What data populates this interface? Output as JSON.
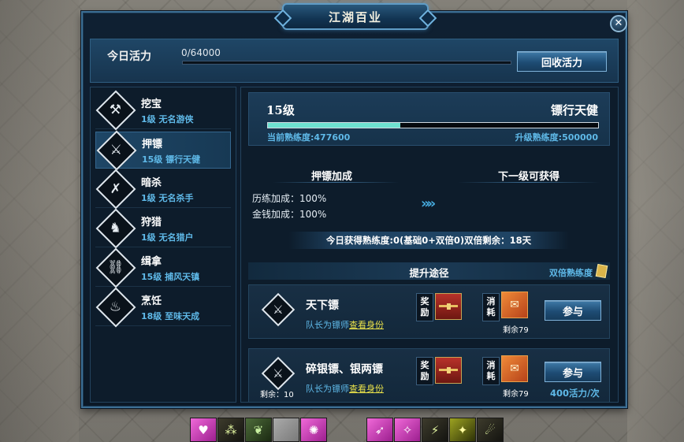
{
  "window": {
    "title": "江湖百业",
    "close_icon": "✕"
  },
  "vitality": {
    "label": "今日活力",
    "value": "0/64000",
    "progress_fraction": 0.0,
    "recycle_button": "回收活力"
  },
  "sidebar": {
    "items": [
      {
        "name": "挖宝",
        "sub": "1级 无名游侠",
        "icon": "shovel-icon",
        "glyph": "⚒"
      },
      {
        "name": "押镖",
        "sub": "15级 镖行天健",
        "icon": "escort-icon",
        "glyph": "⚔"
      },
      {
        "name": "暗杀",
        "sub": "1级 无名杀手",
        "icon": "daggers-icon",
        "glyph": "✗"
      },
      {
        "name": "狩猎",
        "sub": "1级 无名猎户",
        "icon": "deer-icon",
        "glyph": "♞"
      },
      {
        "name": "缉拿",
        "sub": "15级 捕风天镇",
        "icon": "handcuff-icon",
        "glyph": "⛓"
      },
      {
        "name": "烹饪",
        "sub": "18级 至味天成",
        "icon": "cooking-icon",
        "glyph": "♨"
      }
    ],
    "selected_index": 1
  },
  "profession": {
    "level": "15级",
    "rank": "镖行天健",
    "current_label": "当前熟练度:477600",
    "next_label": "升级熟练度:500000",
    "progress_fraction": 0.4
  },
  "bonus": {
    "heading": "押镖加成",
    "next_heading": "下一级可获得",
    "lines": [
      "历练加成：100%",
      "金钱加成：100%"
    ],
    "arrow": "»»"
  },
  "today_line": "今日获得熟练度:0(基础0+双倍0)双倍剩余：18天",
  "routes": {
    "heading": "提升途径",
    "double_label": "双倍熟练度",
    "reward_tag": [
      "奖",
      "励"
    ],
    "cost_tag": [
      "消",
      "耗"
    ],
    "items": [
      {
        "name": "天下镖",
        "leader": "队长为镖师",
        "link": "查看身份",
        "token_remain": "剩余79",
        "join": "参与",
        "remain": "",
        "cost": ""
      },
      {
        "name": "碎银镖、银两镖",
        "leader": "队长为镖师",
        "link": "查看身份",
        "token_remain": "剩余79",
        "join": "参与",
        "remain": "剩余：10",
        "cost": "400活力/次"
      }
    ]
  },
  "hotbar": {
    "left": [
      {
        "icon": "couple-skill-icon",
        "glyph": "♥",
        "style": "pink"
      },
      {
        "icon": "claw-skill-icon",
        "glyph": "⁂",
        "style": "dark"
      },
      {
        "icon": "leaf-skill-icon",
        "glyph": "❦",
        "style": "green"
      },
      {
        "icon": "empty-slot-icon",
        "glyph": "",
        "style": "grey"
      },
      {
        "icon": "burst-skill-icon",
        "glyph": "✺",
        "style": "pink"
      }
    ],
    "right": [
      {
        "icon": "dash-skill-icon",
        "glyph": "➶",
        "style": "pink"
      },
      {
        "icon": "spin-skill-icon",
        "glyph": "✧",
        "style": "pink"
      },
      {
        "icon": "slash-skill-icon",
        "glyph": "⚡",
        "style": "dark"
      },
      {
        "icon": "strike-skill-icon",
        "glyph": "✦",
        "style": "yellow"
      },
      {
        "icon": "kick-skill-icon",
        "glyph": "☄",
        "style": "dark"
      }
    ]
  }
}
